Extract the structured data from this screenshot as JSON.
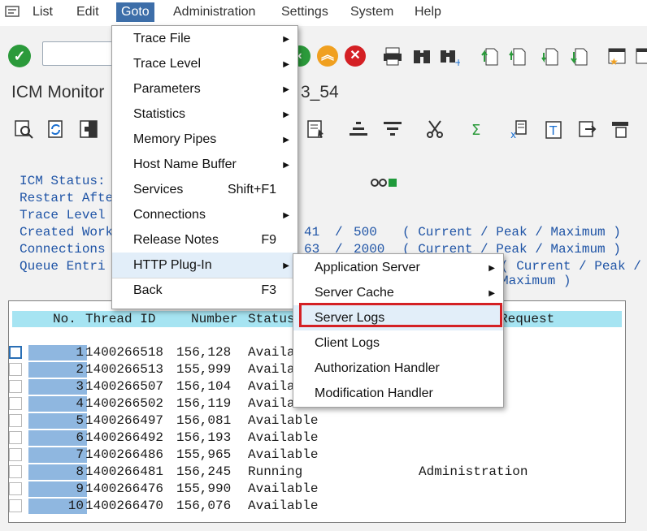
{
  "menubar": {
    "items": [
      "List",
      "Edit",
      "Goto",
      "Administration",
      "Settings",
      "System",
      "Help"
    ],
    "active": "Goto"
  },
  "toolbar": {
    "icons": [
      "enter-icon",
      "command-field",
      "back-icon",
      "exit-icon",
      "cancel-icon",
      "print-icon",
      "find-icon",
      "find-next-icon",
      "first-page-icon",
      "previous-page-icon",
      "next-page-icon",
      "last-page-icon",
      "create-session-icon",
      "shortcut-icon"
    ]
  },
  "title": {
    "left": "ICM Monitor",
    "right": "3_54"
  },
  "info": {
    "labels": [
      "ICM Status:",
      "Restart Afte",
      "Trace Level",
      "Created Work",
      "Connections",
      "Queue Entri"
    ],
    "row3_values": {
      "current": "41",
      "sep": "/",
      "max": "500",
      "legend": "( Current / Peak / Maximum )"
    },
    "row4_values": {
      "current": "63",
      "sep": "/",
      "max": "2000",
      "legend": "( Current / Peak / Maximum )"
    },
    "row5_values": {
      "legend": "( Current / Peak / Maximum )"
    },
    "status_icon": "oo-green-status-icon"
  },
  "table": {
    "headers": {
      "no": "No.",
      "thread_id": "Thread ID",
      "number": "Number",
      "status": "Status",
      "request": "Request"
    },
    "rows": [
      {
        "no": "1",
        "thread": "1400266518",
        "number": "156,128",
        "status": "Availa",
        "request": ""
      },
      {
        "no": "2",
        "thread": "1400266513",
        "number": "155,999",
        "status": "Availa",
        "request": ""
      },
      {
        "no": "3",
        "thread": "1400266507",
        "number": "156,104",
        "status": "Availa",
        "request": ""
      },
      {
        "no": "4",
        "thread": "1400266502",
        "number": "156,119",
        "status": "Availa",
        "request": ""
      },
      {
        "no": "5",
        "thread": "1400266497",
        "number": "156,081",
        "status": "Available",
        "request": ""
      },
      {
        "no": "6",
        "thread": "1400266492",
        "number": "156,193",
        "status": "Available",
        "request": ""
      },
      {
        "no": "7",
        "thread": "1400266486",
        "number": "155,965",
        "status": "Available",
        "request": ""
      },
      {
        "no": "8",
        "thread": "1400266481",
        "number": "156,245",
        "status": "Running",
        "request": "Administration"
      },
      {
        "no": "9",
        "thread": "1400266476",
        "number": "155,990",
        "status": "Available",
        "request": ""
      },
      {
        "no": "10",
        "thread": "1400266470",
        "number": "156,076",
        "status": "Available",
        "request": ""
      }
    ]
  },
  "goto_menu": {
    "items": [
      {
        "label": "Trace File",
        "shortcut": "",
        "submenu": true
      },
      {
        "label": "Trace Level",
        "shortcut": "",
        "submenu": true
      },
      {
        "label": "Parameters",
        "shortcut": "",
        "submenu": true
      },
      {
        "label": "Statistics",
        "shortcut": "",
        "submenu": true
      },
      {
        "label": "Memory Pipes",
        "shortcut": "",
        "submenu": true
      },
      {
        "label": "Host Name Buffer",
        "shortcut": "",
        "submenu": true
      },
      {
        "label": "Services",
        "shortcut": "Shift+F1",
        "submenu": false
      },
      {
        "label": "Connections",
        "shortcut": "",
        "submenu": true
      },
      {
        "label": "Release Notes",
        "shortcut": "F9",
        "submenu": false
      },
      {
        "label": "HTTP Plug-In",
        "shortcut": "",
        "submenu": true
      },
      {
        "label": "Back",
        "shortcut": "F3",
        "submenu": false
      }
    ]
  },
  "plugin_submenu": {
    "items": [
      {
        "label": "Application Server",
        "submenu": true
      },
      {
        "label": "Server Cache",
        "submenu": true
      },
      {
        "label": "Server Logs",
        "submenu": false
      },
      {
        "label": "Client Logs",
        "submenu": false
      },
      {
        "label": "Authorization Handler",
        "submenu": false
      },
      {
        "label": "Modification Handler",
        "submenu": false
      }
    ],
    "highlighted": "Server Logs"
  },
  "colors": {
    "accent": "#3d6ea9",
    "info_text": "#1f54a6",
    "table_header": "#a6e4f2",
    "row_number": "#8fb7e0",
    "highlight_box": "#d42024",
    "ok_green": "#2b9a3b"
  }
}
